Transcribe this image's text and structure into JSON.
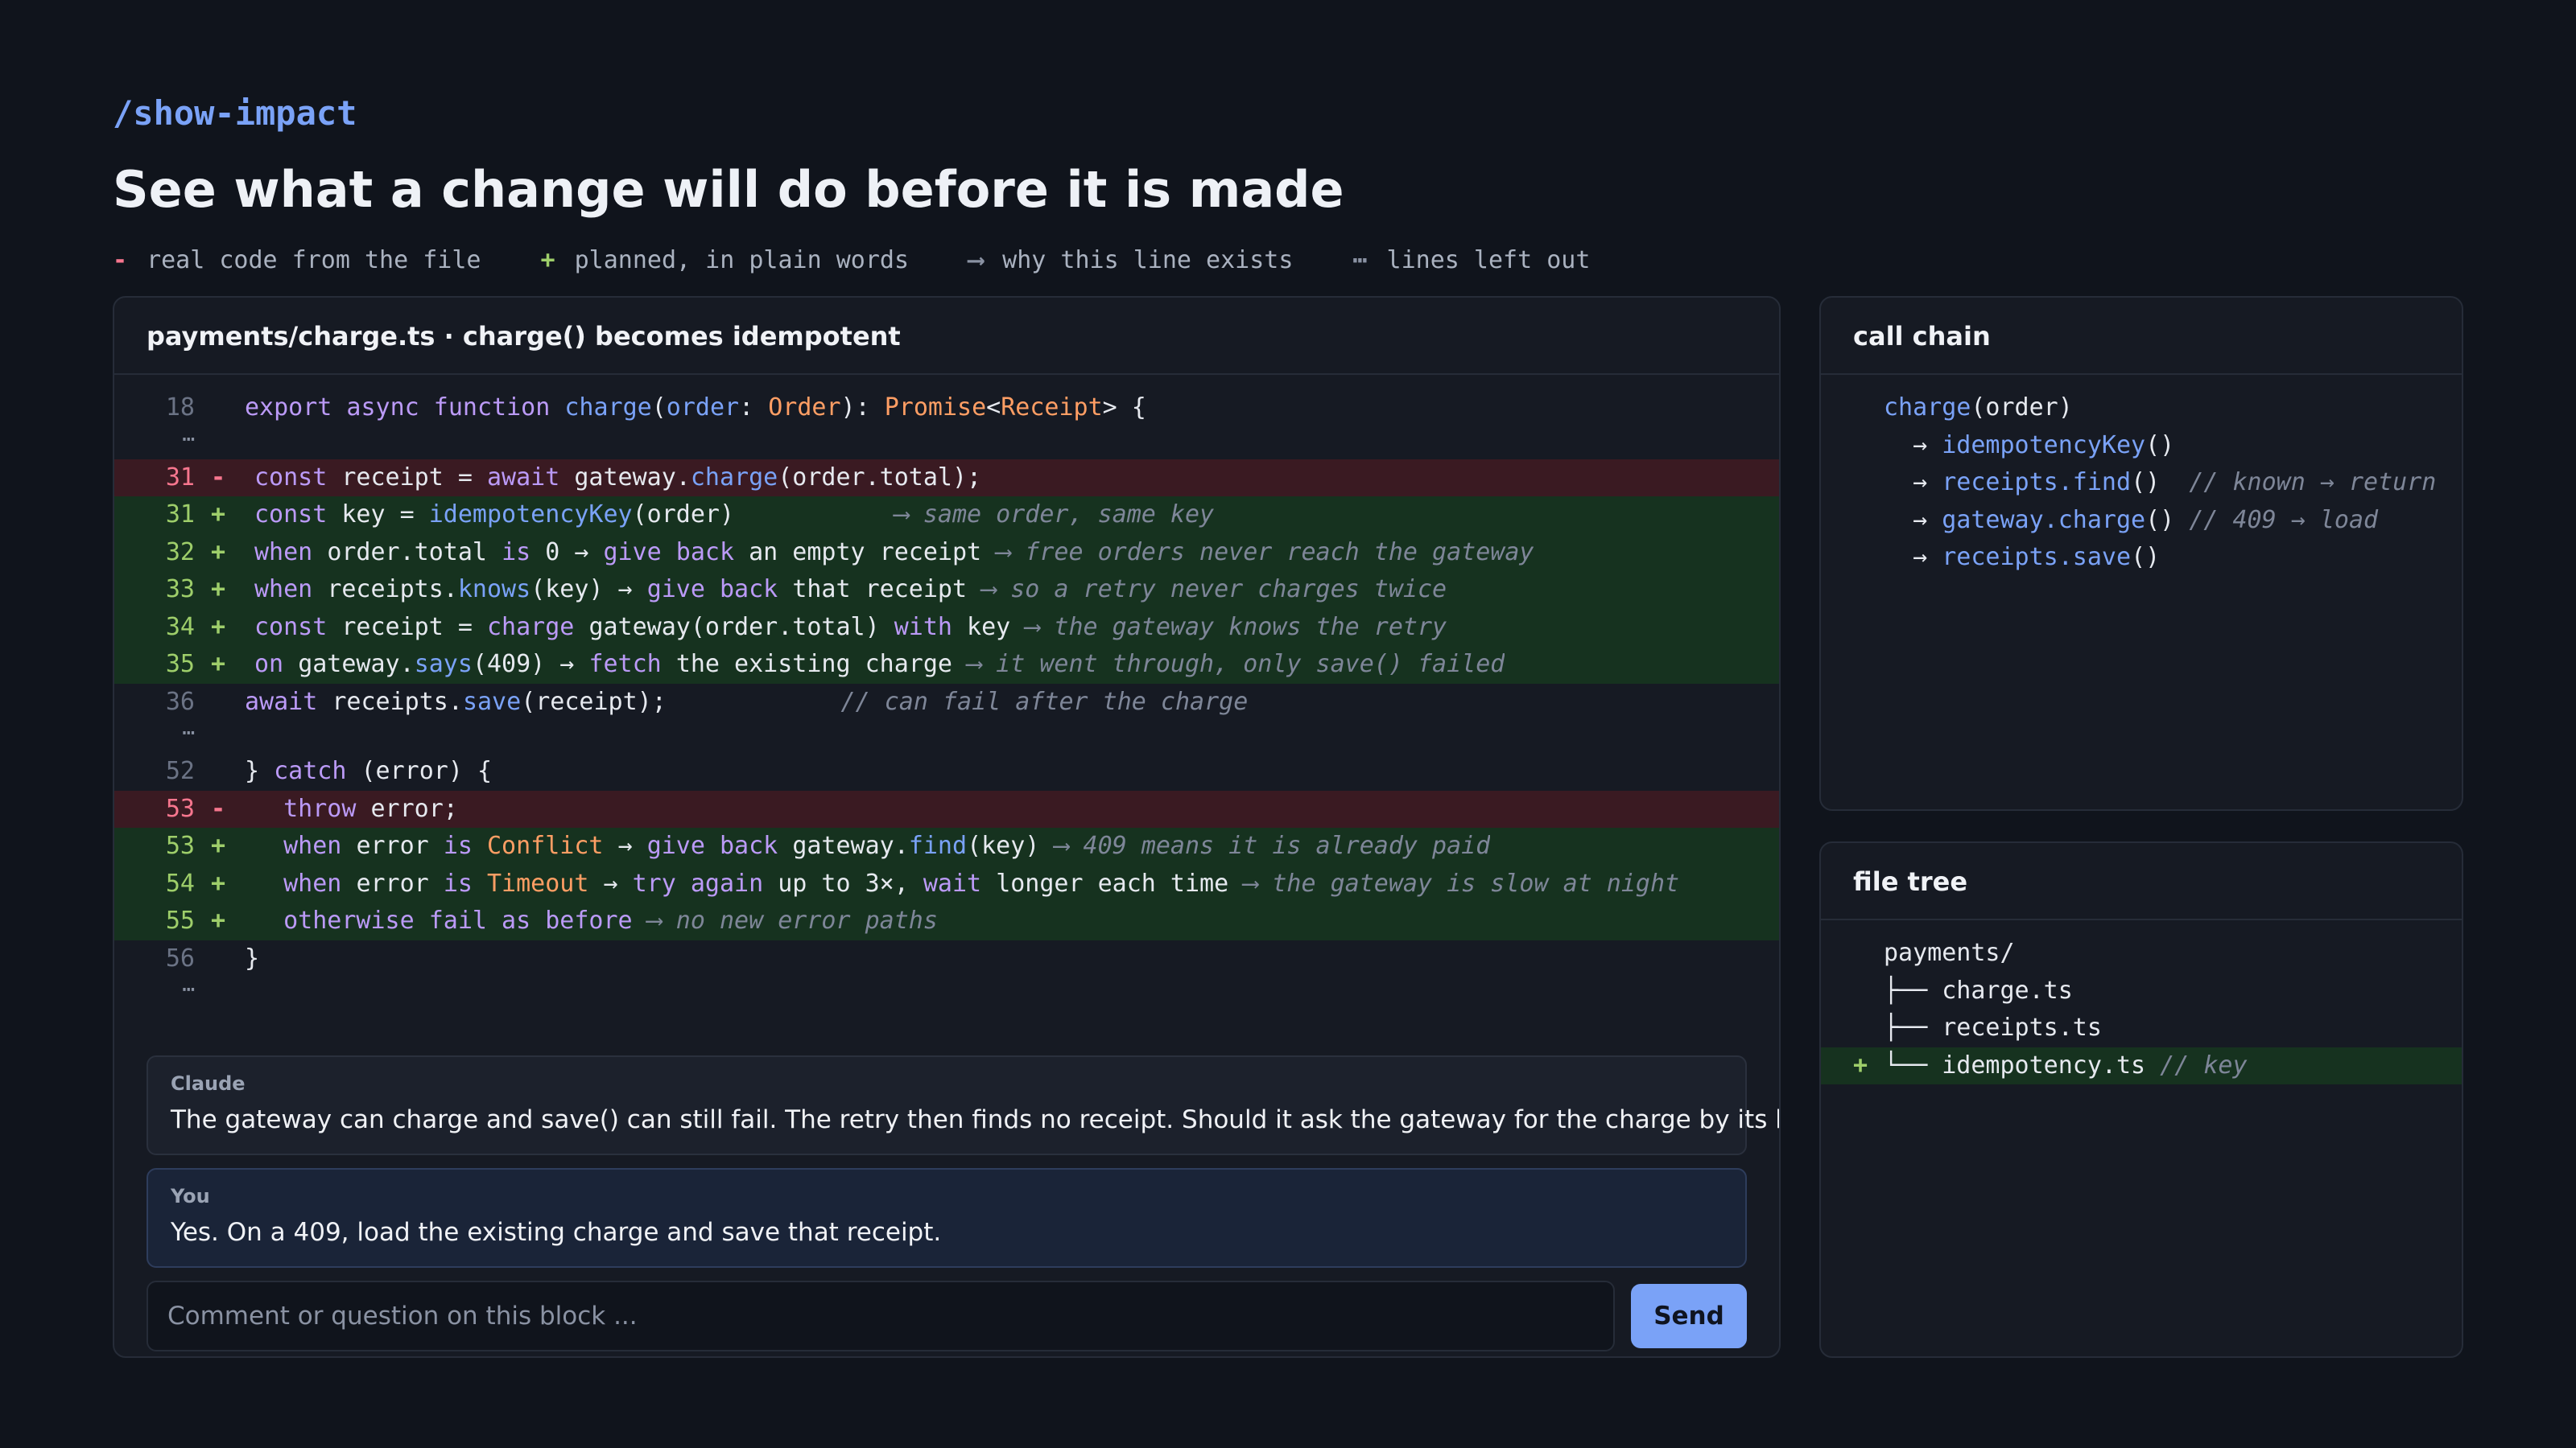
{
  "header": {
    "command": "/show-impact",
    "title": "See what a change will do before it is made",
    "legend": [
      {
        "symbol": "-",
        "label": "real code from the file",
        "kind": "minus"
      },
      {
        "symbol": "+",
        "label": "planned, in plain words",
        "kind": "plus"
      },
      {
        "symbol": "⟶",
        "label": "why this line exists",
        "kind": "arrow"
      },
      {
        "symbol": "⋯",
        "label": "lines left out",
        "kind": "dots"
      }
    ]
  },
  "diff_panel": {
    "title": "payments/charge.ts · charge() becomes idempotent",
    "lines": [
      {
        "num": "18",
        "kind": "ctx",
        "parts": [
          [
            "kw",
            "export async function "
          ],
          [
            "fn",
            "charge"
          ],
          [
            "",
            "("
          ],
          [
            "fn",
            "order"
          ],
          [
            "",
            ": "
          ],
          [
            "ty",
            "Order"
          ],
          [
            "",
            "): "
          ],
          [
            "ty",
            "Promise"
          ],
          [
            "",
            "<"
          ],
          [
            "ty",
            "Receipt"
          ],
          [
            "",
            "> {"
          ]
        ]
      },
      {
        "num": "⋯",
        "kind": "gap",
        "parts": []
      },
      {
        "num": "31",
        "kind": "del",
        "parts": [
          [
            "kw",
            "const "
          ],
          [
            "",
            "receipt = "
          ],
          [
            "kw",
            "await "
          ],
          [
            "",
            "gateway."
          ],
          [
            "fn",
            "charge"
          ],
          [
            "",
            "(order.total);"
          ]
        ]
      },
      {
        "num": "31",
        "kind": "add",
        "parts": [
          [
            "kw",
            "const "
          ],
          [
            "",
            "key = "
          ],
          [
            "fn",
            "idempotencyKey"
          ],
          [
            "",
            "(order)           "
          ],
          [
            "cm",
            "⟶ same order, same key"
          ]
        ]
      },
      {
        "num": "32",
        "kind": "add",
        "parts": [
          [
            "kw",
            "when "
          ],
          [
            "",
            "order.total "
          ],
          [
            "kw",
            "is "
          ],
          [
            "",
            "0 → "
          ],
          [
            "kw",
            "give back "
          ],
          [
            "",
            "an empty receipt "
          ],
          [
            "cm",
            "⟶ free orders never reach the gateway"
          ]
        ]
      },
      {
        "num": "33",
        "kind": "add",
        "parts": [
          [
            "kw",
            "when "
          ],
          [
            "",
            "receipts."
          ],
          [
            "fn",
            "knows"
          ],
          [
            "",
            "(key) → "
          ],
          [
            "kw",
            "give back "
          ],
          [
            "",
            "that receipt "
          ],
          [
            "cm",
            "⟶ so a retry never charges twice"
          ]
        ]
      },
      {
        "num": "34",
        "kind": "add",
        "parts": [
          [
            "kw",
            "const "
          ],
          [
            "",
            "receipt = "
          ],
          [
            "kw",
            "charge "
          ],
          [
            "",
            "gateway(order.total) "
          ],
          [
            "kw",
            "with "
          ],
          [
            "",
            "key "
          ],
          [
            "cm",
            "⟶ the gateway knows the retry"
          ]
        ]
      },
      {
        "num": "35",
        "kind": "add",
        "parts": [
          [
            "kw",
            "on "
          ],
          [
            "",
            "gateway."
          ],
          [
            "fn",
            "says"
          ],
          [
            "",
            "(409) → "
          ],
          [
            "kw",
            "fetch "
          ],
          [
            "",
            "the existing charge "
          ],
          [
            "cm",
            "⟶ it went through, only save() failed"
          ]
        ]
      },
      {
        "num": "36",
        "kind": "ctx",
        "parts": [
          [
            "kw",
            "await "
          ],
          [
            "",
            "receipts."
          ],
          [
            "fn",
            "save"
          ],
          [
            "",
            "(receipt);            "
          ],
          [
            "cm",
            "// can fail after the charge"
          ]
        ]
      },
      {
        "num": "⋯",
        "kind": "gap",
        "parts": []
      },
      {
        "num": "52",
        "kind": "ctx",
        "parts": [
          [
            "",
            "} "
          ],
          [
            "kw",
            "catch "
          ],
          [
            "",
            "(error) {"
          ]
        ]
      },
      {
        "num": "53",
        "kind": "del",
        "parts": [
          [
            "",
            "  "
          ],
          [
            "kw",
            "throw "
          ],
          [
            "",
            "error;"
          ]
        ]
      },
      {
        "num": "53",
        "kind": "add",
        "parts": [
          [
            "",
            "  "
          ],
          [
            "kw",
            "when "
          ],
          [
            "",
            "error "
          ],
          [
            "kw",
            "is "
          ],
          [
            "ty",
            "Conflict "
          ],
          [
            "",
            "→ "
          ],
          [
            "kw",
            "give back "
          ],
          [
            "",
            "gateway."
          ],
          [
            "fn",
            "find"
          ],
          [
            "",
            "(key) "
          ],
          [
            "cm",
            "⟶ 409 means it is already paid"
          ]
        ]
      },
      {
        "num": "54",
        "kind": "add",
        "parts": [
          [
            "",
            "  "
          ],
          [
            "kw",
            "when "
          ],
          [
            "",
            "error "
          ],
          [
            "kw",
            "is "
          ],
          [
            "ty",
            "Timeout "
          ],
          [
            "",
            "→ "
          ],
          [
            "kw",
            "try again "
          ],
          [
            "",
            "up to 3×, "
          ],
          [
            "kw",
            "wait "
          ],
          [
            "",
            "longer each time "
          ],
          [
            "cm",
            "⟶ the gateway is slow at night"
          ]
        ]
      },
      {
        "num": "55",
        "kind": "add",
        "parts": [
          [
            "",
            "  "
          ],
          [
            "kw",
            "otherwise fail as before "
          ],
          [
            "cm",
            "⟶ no new error paths"
          ]
        ]
      },
      {
        "num": "56",
        "kind": "ctx",
        "parts": [
          [
            "",
            "}"
          ]
        ]
      },
      {
        "num": "⋯",
        "kind": "gap",
        "parts": []
      }
    ],
    "chat": {
      "claude_author": "Claude",
      "claude_message": "The gateway can charge and save() can still fail. The retry then finds no receipt. Should it ask the gateway for the charge by its key?",
      "you_author": "You",
      "you_message": "Yes. On a 409, load the existing charge and save that receipt.",
      "input_placeholder": "Comment or question on this block ...",
      "send_label": "Send"
    }
  },
  "call_chain": {
    "title": "call chain",
    "lines": [
      {
        "parts": [
          [
            "fn",
            "charge"
          ],
          [
            "",
            "(order)"
          ]
        ]
      },
      {
        "parts": [
          [
            "",
            "  → "
          ],
          [
            "fn",
            "idempotencyKey"
          ],
          [
            "",
            "()"
          ]
        ]
      },
      {
        "parts": [
          [
            "",
            "  → "
          ],
          [
            "fn",
            "receipts.find"
          ],
          [
            "",
            "()  "
          ],
          [
            "cm",
            "// known → return"
          ]
        ]
      },
      {
        "parts": [
          [
            "",
            "  → "
          ],
          [
            "fn",
            "gateway.charge"
          ],
          [
            "",
            "() "
          ],
          [
            "cm",
            "// 409 → load"
          ]
        ]
      },
      {
        "parts": [
          [
            "",
            "  → "
          ],
          [
            "fn",
            "receipts.save"
          ],
          [
            "",
            "()"
          ]
        ]
      }
    ]
  },
  "file_tree": {
    "title": "file tree",
    "lines": [
      {
        "added": false,
        "parts": [
          [
            "",
            "payments/"
          ]
        ]
      },
      {
        "added": false,
        "parts": [
          [
            "",
            "├── charge.ts"
          ]
        ]
      },
      {
        "added": false,
        "parts": [
          [
            "",
            "├── receipts.ts"
          ]
        ]
      },
      {
        "added": true,
        "plus": "+",
        "parts": [
          [
            "",
            "└── idempotency.ts "
          ],
          [
            "cm",
            "// key"
          ]
        ]
      }
    ]
  },
  "colors": {
    "accent": "#7aa2f7",
    "removed": "#f7768e",
    "added": "#9ece6a",
    "background": "#10141c"
  }
}
